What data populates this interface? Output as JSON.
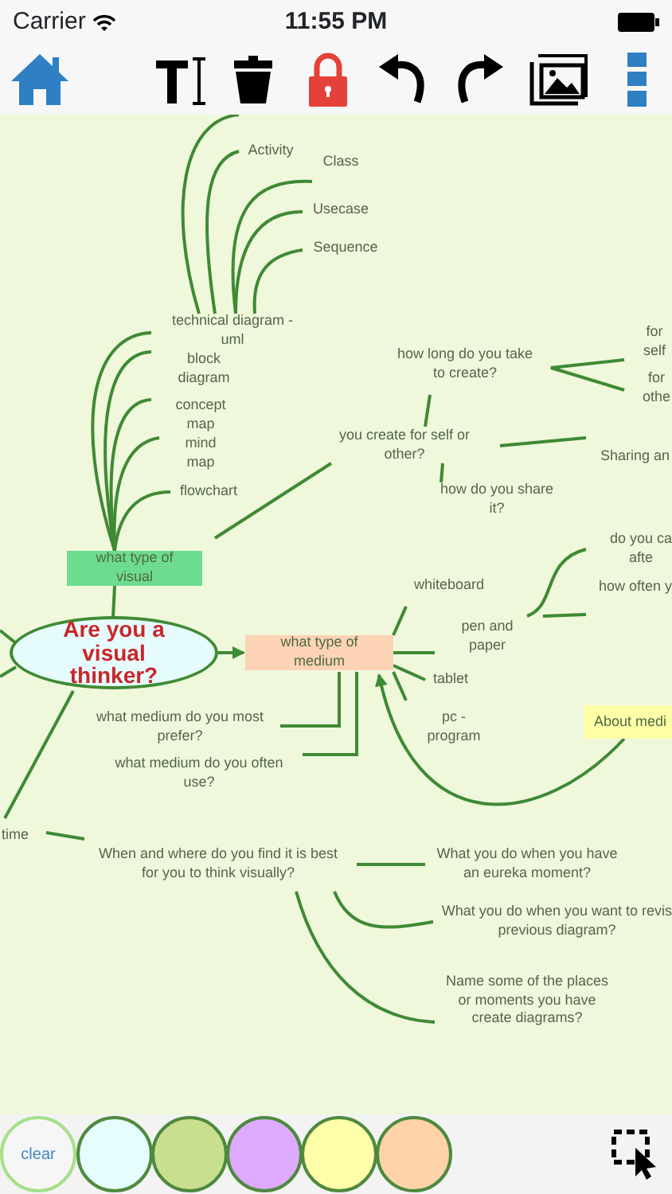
{
  "status_bar": {
    "carrier": "Carrier",
    "time": "11:55 PM"
  },
  "map": {
    "nodes": [
      {
        "kind": "label",
        "text": "Activity"
      },
      {
        "kind": "label",
        "text": "Class"
      },
      {
        "kind": "label",
        "text": "Usecase"
      },
      {
        "kind": "label",
        "text": "Sequence"
      },
      {
        "kind": "label",
        "text": "technical diagram -\numl"
      },
      {
        "kind": "label",
        "text": "block\ndiagram"
      },
      {
        "kind": "label",
        "text": "concept\nmap"
      },
      {
        "kind": "label",
        "text": "mind\nmap"
      },
      {
        "kind": "label",
        "text": "flowchart"
      },
      {
        "kind": "label",
        "text": "how long do you take\nto create?"
      },
      {
        "kind": "label",
        "text": "for\nself"
      },
      {
        "kind": "label",
        "text": "for\nothe"
      },
      {
        "kind": "label",
        "text": "you create for self or\nother?"
      },
      {
        "kind": "label",
        "text": "Sharing an"
      },
      {
        "kind": "label",
        "text": "how do you share\nit?"
      },
      {
        "kind": "box",
        "text": "what type of\nvisual",
        "color": "#6ddc8f"
      },
      {
        "kind": "label",
        "text": "do you ca\nafte"
      },
      {
        "kind": "label",
        "text": "how often y"
      },
      {
        "kind": "label",
        "text": "whiteboard"
      },
      {
        "kind": "label",
        "text": "pen and\npaper"
      },
      {
        "kind": "label",
        "text": "tablet"
      },
      {
        "kind": "label",
        "text": "pc -\nprogram"
      },
      {
        "kind": "note",
        "text": "About medi",
        "color": "#ffffa8"
      },
      {
        "kind": "ellipse",
        "text": "Are you a\nvisual\nthinker?",
        "color": "#e6fcfc"
      },
      {
        "kind": "box",
        "text": "what type of\nmedium",
        "color": "#fdd3b5"
      },
      {
        "kind": "label",
        "text": "what medium do you most\nprefer?"
      },
      {
        "kind": "label",
        "text": "what medium do you often\nuse?"
      },
      {
        "kind": "label",
        "text": "time"
      },
      {
        "kind": "label",
        "text": "When and where do you find it is best\nfor you to think visually?"
      },
      {
        "kind": "label",
        "text": "What you do when you have\nan eureka moment?"
      },
      {
        "kind": "label",
        "text": "What you do when you want to revis\nprevious diagram?"
      },
      {
        "kind": "label",
        "text": "Name some of the places\nor moments you have\ncreate diagrams?"
      }
    ]
  },
  "palette": {
    "clear_label": "clear",
    "swatches": [
      {
        "color": "#e6fdfd"
      },
      {
        "color": "#c8df8f"
      },
      {
        "color": "#ddaaff"
      },
      {
        "color": "#ffffaa"
      },
      {
        "color": "#ffd3aa"
      }
    ]
  }
}
